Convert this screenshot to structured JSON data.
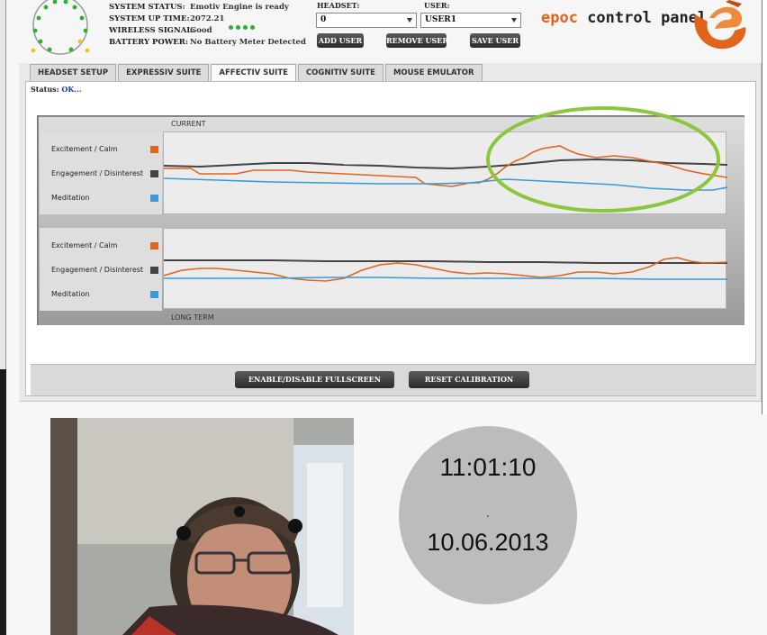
{
  "status": {
    "system_status_label": "SYSTEM STATUS:",
    "system_status_value": "Emotiv Engine is ready",
    "uptime_label": "SYSTEM UP TIME:",
    "uptime_value": "2072.21",
    "wireless_label": "WIRELESS SIGNAL:",
    "wireless_value": "Good",
    "battery_label": "BATTERY POWER:",
    "battery_value": "No Battery Meter Detected",
    "signal_dot_color": "#2bb22b"
  },
  "headset": {
    "label": "HEADSET:",
    "value": "0"
  },
  "user": {
    "label": "USER:",
    "value": "USER1"
  },
  "buttons": {
    "add_user": "ADD USER",
    "remove_user": "REMOVE USER",
    "save_user": "SAVE USER",
    "fullscreen": "ENABLE/DISABLE FULLSCREEN",
    "reset_calibration": "RESET CALIBRATION"
  },
  "brand": {
    "part1": "epoc",
    "part2": " control panel",
    "accent": "#e0641b"
  },
  "tabs": [
    {
      "label": "HEADSET SETUP",
      "active": false
    },
    {
      "label": "EXPRESSIV SUITE",
      "active": false
    },
    {
      "label": "AFFECTIV SUITE",
      "active": true
    },
    {
      "label": "COGNITIV SUITE",
      "active": false
    },
    {
      "label": "MOUSE EMULATOR",
      "active": false
    }
  ],
  "status_line": {
    "label": "Status:",
    "value": "OK..."
  },
  "graphs": {
    "current_label": "CURRENT",
    "longterm_label": "LONG TERM",
    "legend": [
      {
        "label": "Excitement / Calm",
        "color": "#e0641b"
      },
      {
        "label": "Engagement / Disinterest",
        "color": "#444444"
      },
      {
        "label": "Meditation",
        "color": "#3a9ad9"
      }
    ],
    "highlight_color": "#8cc63f"
  },
  "clock": {
    "time": "11:01:10",
    "date": "10.06.2013"
  }
}
